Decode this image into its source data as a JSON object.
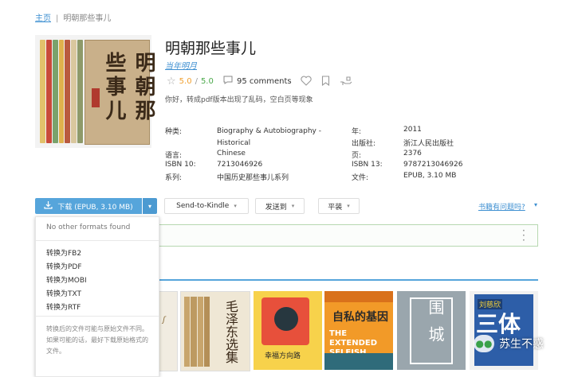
{
  "breadcrumb": {
    "home": "主页",
    "separator": "|",
    "current": "明朝那些事儿"
  },
  "book": {
    "title": "明朝那些事儿",
    "author": "当年明月",
    "rating": "5.0",
    "rating_sep": "/",
    "rating_max": "5.0",
    "comments": "95 comments",
    "description": "你好，转成pdf版本出现了乱码，空白页等现象",
    "cover_text": "明朝那些事儿"
  },
  "meta": {
    "category_label": "种类:",
    "category_value": "Biography & Autobiography - Historical",
    "year_label": "年:",
    "year_value": "2011",
    "publisher_label": "出版社:",
    "publisher_value": "浙江人民出版社",
    "language_label": "语言:",
    "language_value": "Chinese",
    "pages_label": "页:",
    "pages_value": "2376",
    "isbn10_label": "ISBN 10:",
    "isbn10_value": "7213046926",
    "isbn13_label": "ISBN 13:",
    "isbn13_value": "9787213046926",
    "series_label": "系列:",
    "series_value": "中国历史那些事儿系列",
    "file_label": "文件:",
    "file_value": "EPUB, 3.10 MB"
  },
  "toolbar": {
    "download_label": "下载 (EPUB, 3.10 MB)",
    "send_kindle": "Send-to-Kindle",
    "send_to": "发送到",
    "flat": "平装",
    "problem_link": "书籍有问题吗?"
  },
  "dropdown": {
    "no_formats": "No other formats found",
    "items": [
      "转换为FB2",
      "转换为PDF",
      "转换为MOBI",
      "转换为TXT",
      "转换为RTF"
    ],
    "note": "转换后的文件可能与原始文件不同。如果可能的话，最好下载原始格式的文件。"
  },
  "related_books": {
    "covers": [
      "毛泽东选集",
      "幸福方向路",
      "自私的基因",
      "围城",
      "三体"
    ],
    "cover2_sub": "THE EXTENDED SELFISH GENE",
    "cover4_author": "刘慈欣"
  },
  "watermark": "苏生不惑",
  "colors": {
    "link": "#3d8fd1",
    "primary": "#56a5db",
    "star": "#f0a030",
    "green": "#4aa84a"
  }
}
